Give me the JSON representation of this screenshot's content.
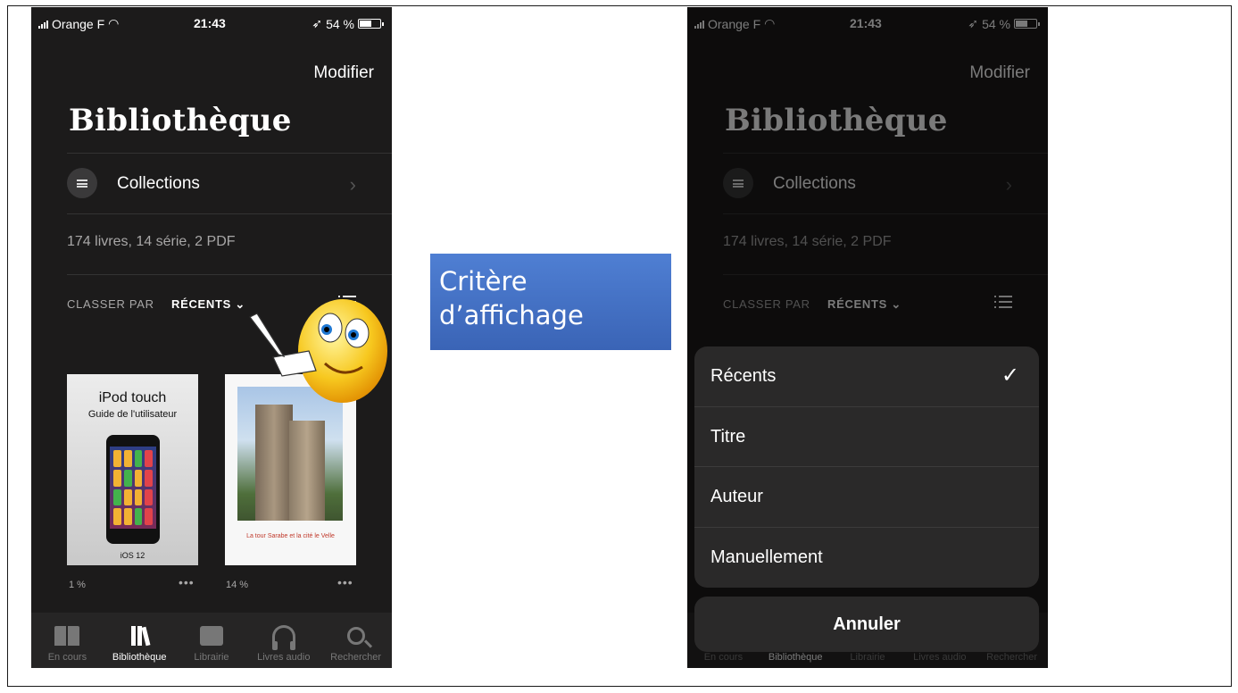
{
  "status_bar": {
    "carrier": "Orange F",
    "time": "21:43",
    "battery": "54 %"
  },
  "header": {
    "modify_label": "Modifier",
    "title": "Bibliothèque"
  },
  "collections_label": "Collections",
  "counts_text": "174 livres, 14 série, 2 PDF",
  "sort": {
    "prefix": "CLASSER PAR",
    "value": "RÉCENTS"
  },
  "books": [
    {
      "title": "iPod touch",
      "subtitle": "Guide de l'utilisateur",
      "badge": "iOS 12",
      "progress": "1 %",
      "more": "•••"
    },
    {
      "caption": "La tour Sarabe et la cité le Velle",
      "progress": "14 %",
      "more": "•••"
    }
  ],
  "tabs": [
    {
      "label": "En cours",
      "icon": "book-open-icon"
    },
    {
      "label": "Bibliothèque",
      "icon": "library-icon"
    },
    {
      "label": "Librairie",
      "icon": "bag-icon"
    },
    {
      "label": "Livres audio",
      "icon": "headphones-icon"
    },
    {
      "label": "Rechercher",
      "icon": "search-icon"
    }
  ],
  "callout": {
    "line1": "Critère",
    "line2": "d’affichage"
  },
  "sort_sheet": {
    "options": [
      "Récents",
      "Titre",
      "Auteur",
      "Manuellement"
    ],
    "selected": "Récents",
    "cancel_label": "Annuler"
  }
}
